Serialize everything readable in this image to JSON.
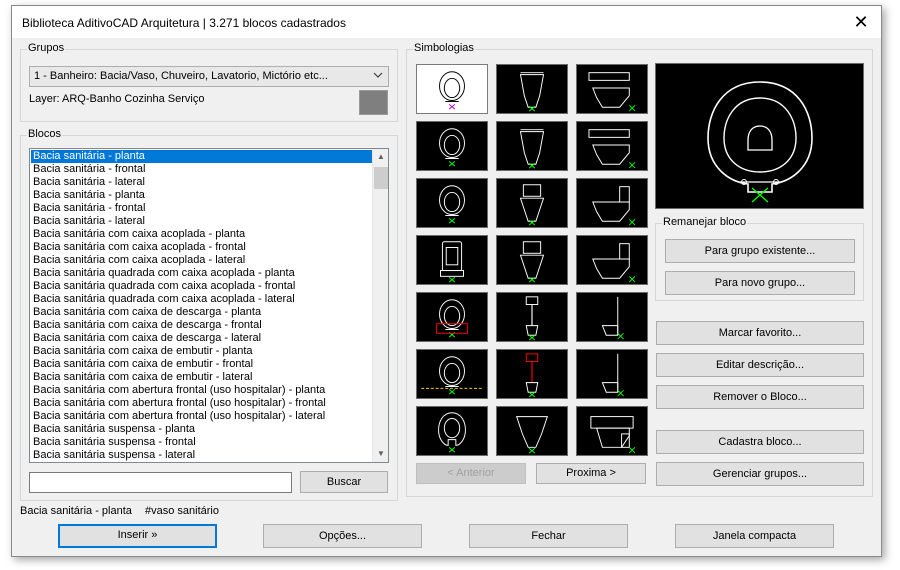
{
  "window": {
    "title": "Biblioteca AditivoCAD Arquitetura |  3.271 blocos cadastrados"
  },
  "grupos": {
    "label": "Grupos",
    "selected": "1 - Banheiro: Bacia/Vaso, Chuveiro, Lavatorio, Mictório etc...",
    "layer_text": "Layer: ARQ-Banho Cozinha Serviço",
    "layer_color": "#7f7f7f"
  },
  "blocos": {
    "label": "Blocos",
    "items": [
      "Bacia sanitária - planta",
      "Bacia sanitária - frontal",
      "Bacia sanitária - lateral",
      "Bacia sanitária - planta",
      "Bacia sanitária - frontal",
      "Bacia sanitária - lateral",
      "Bacia sanitária com caixa acoplada - planta",
      "Bacia sanitária com caixa acoplada - frontal",
      "Bacia sanitária com caixa acoplada - lateral",
      "Bacia sanitária quadrada com caixa acoplada - planta",
      "Bacia sanitária quadrada com caixa acoplada - frontal",
      "Bacia sanitária quadrada com caixa acoplada - lateral",
      "Bacia sanitária com caixa de descarga - planta",
      "Bacia sanitária com caixa de descarga - frontal",
      "Bacia sanitária com caixa de descarga - lateral",
      "Bacia sanitária com caixa de embutir - planta",
      "Bacia sanitária com caixa de embutir - frontal",
      "Bacia sanitária com caixa de embutir - lateral",
      "Bacia sanitária com abertura frontal (uso hospitalar) - planta",
      "Bacia sanitária com abertura frontal (uso hospitalar) - frontal",
      "Bacia sanitária com abertura frontal (uso hospitalar) - lateral",
      "Bacia sanitária suspensa - planta",
      "Bacia sanitária suspensa - frontal",
      "Bacia sanitária suspensa - lateral"
    ],
    "selected_index": 0,
    "search_value": "",
    "search_button": "Buscar"
  },
  "simbologias": {
    "label": "Simbologias",
    "thumbs": [
      [
        "toilet-plan-icon",
        "toilet-front-icon",
        "toilet-side-icon"
      ],
      [
        "toilet-plan-icon",
        "toilet-front-icon",
        "toilet-side-icon"
      ],
      [
        "toilet-tank-plan-icon",
        "toilet-tank-front-icon",
        "toilet-tank-side-icon"
      ],
      [
        "toilet-square-plan-icon",
        "toilet-square-front-icon",
        "toilet-square-side-icon"
      ],
      [
        "toilet-flush-plan-icon",
        "toilet-flush-front-icon",
        "toilet-flush-side-icon"
      ],
      [
        "toilet-embed-plan-icon",
        "toilet-embed-front-icon",
        "toilet-embed-side-icon"
      ],
      [
        "toilet-hospital-plan-icon",
        "toilet-hospital-front-icon",
        "toilet-hospital-side-icon"
      ]
    ],
    "selected_row": 0,
    "selected_col": 0,
    "prev_button": "< Anterior",
    "next_button": "Proxima >"
  },
  "remanejar": {
    "label": "Remanejar bloco",
    "existing_button": "Para grupo existente...",
    "new_button": "Para novo grupo..."
  },
  "actions": {
    "favorite": "Marcar favorito...",
    "edit_desc": "Editar descrição...",
    "remove": "Remover o Bloco...",
    "register": "Cadastra bloco...",
    "manage": "Gerenciar grupos..."
  },
  "status": {
    "block_name": "Bacia sanitária - planta",
    "tag": "#vaso sanitário"
  },
  "footer": {
    "insert": "Inserir  »",
    "options": "Opções...",
    "close": "Fechar",
    "compact": "Janela compacta"
  },
  "colors": {
    "accent": "#0078d7",
    "thumb_bg": "#000000",
    "line": "#ffffff",
    "marker": "#00ff00",
    "hi": "#ff0000"
  }
}
